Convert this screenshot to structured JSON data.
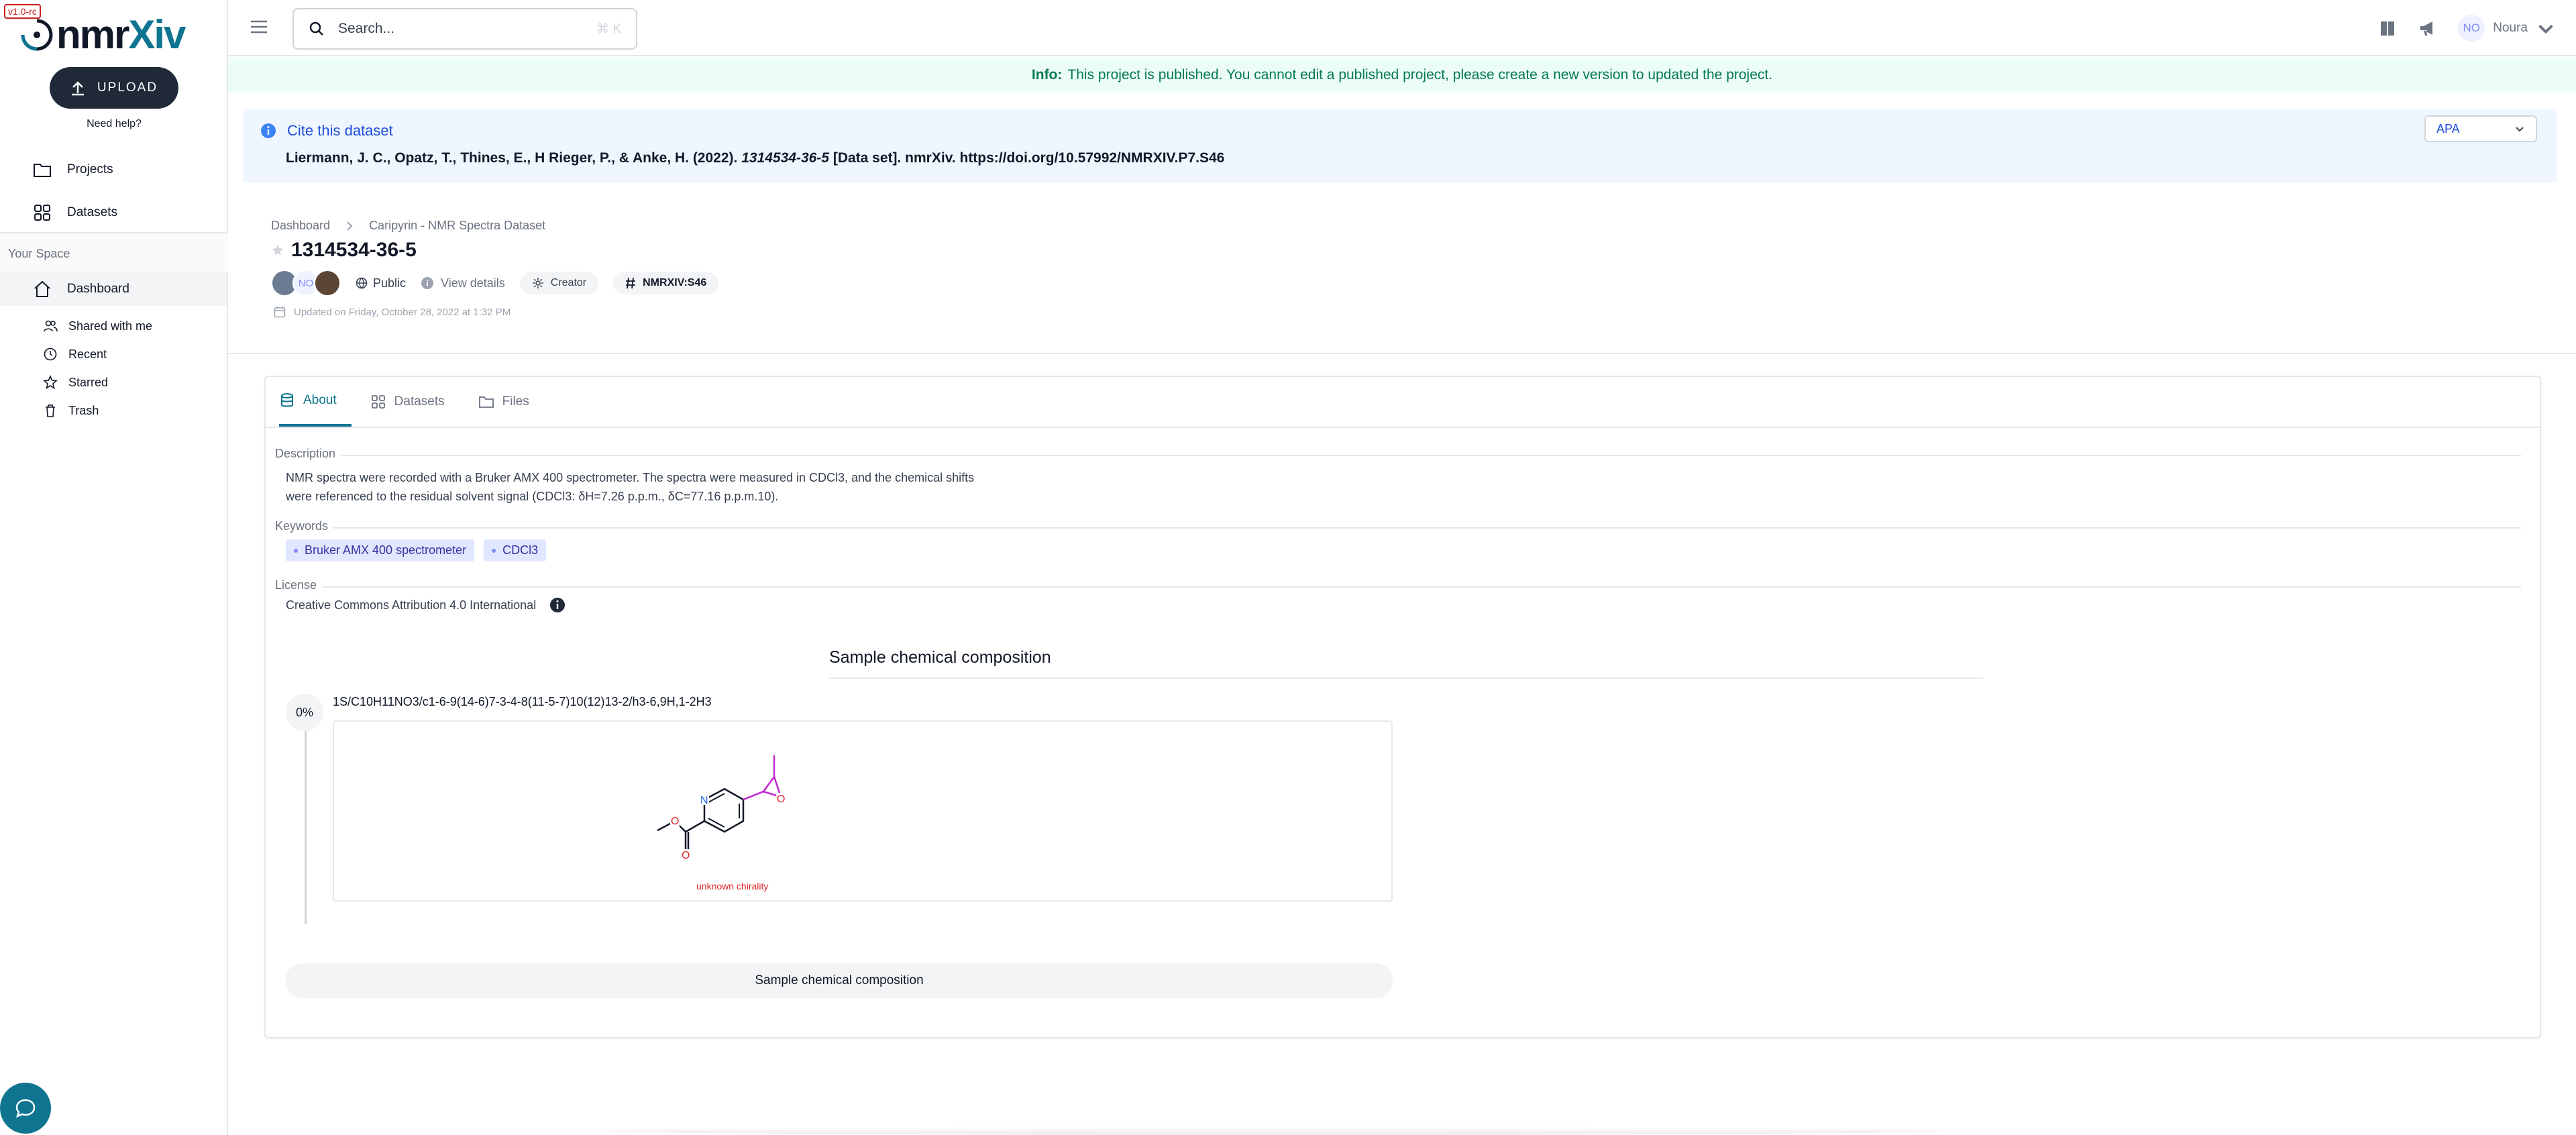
{
  "app": {
    "version": "v1.0-rc",
    "logo_text_main": "nmr",
    "logo_text_accent": "Xiv",
    "upload_label": "UPLOAD",
    "need_help": "Need help?"
  },
  "sidebar": {
    "items": [
      {
        "label": "Projects",
        "icon": "folder-icon"
      },
      {
        "label": "Datasets",
        "icon": "grid-icon"
      }
    ],
    "section_label": "Your Space",
    "dashboard_label": "Dashboard",
    "sub_items": [
      {
        "label": "Shared with me",
        "icon": "users-icon"
      },
      {
        "label": "Recent",
        "icon": "clock-icon"
      },
      {
        "label": "Starred",
        "icon": "star-icon"
      },
      {
        "label": "Trash",
        "icon": "trash-icon"
      }
    ]
  },
  "topbar": {
    "search_placeholder": "Search...",
    "search_shortcut": "⌘ K",
    "user_initials": "NO",
    "user_name": "Noura"
  },
  "banner": {
    "prefix": "Info:",
    "message": "This project is published. You cannot edit a published project, please create a new version to updated the project."
  },
  "cite": {
    "title": "Cite this dataset",
    "authors": "Liermann, J. C., Opatz, T., Thines, E., H Rieger, P., & Anke, H. (2022).",
    "dataset_title": "1314534-36-5",
    "rest": "[Data set]. nmrXiv. https://doi.org/10.57992/NMRXIV.P7.S46",
    "format": "APA"
  },
  "header": {
    "breadcrumb_root": "Dashboard",
    "breadcrumb_project": "Caripyrin - NMR Spectra Dataset",
    "title": "1314534-36-5",
    "avatar_initials": "NO",
    "visibility": "Public",
    "view_details": "View details",
    "role": "Creator",
    "identifier": "NMRXIV:S46",
    "updated": "Updated on Friday, October 28, 2022 at 1:32 PM"
  },
  "tabs": [
    {
      "label": "About",
      "icon": "database-icon",
      "active": true
    },
    {
      "label": "Datasets",
      "icon": "grid-icon",
      "active": false
    },
    {
      "label": "Files",
      "icon": "folder-icon",
      "active": false
    }
  ],
  "about": {
    "description_label": "Description",
    "description_line1": "NMR spectra were recorded with a Bruker AMX 400 spectrometer. The spectra were measured in CDCl3, and the chemical shifts",
    "description_line2": "were referenced to the residual solvent signal (CDCl3: δH=7.26 p.p.m., δC=77.16 p.p.m.10).",
    "keywords_label": "Keywords",
    "keywords": [
      "Bruker AMX 400 spectrometer",
      "CDCl3"
    ],
    "license_label": "License",
    "license": "Creative Commons Attribution 4.0 International"
  },
  "composition": {
    "title": "Sample chemical composition",
    "percent": "0%",
    "inchi": "1S/C10H11NO3/c1-6-9(14-6)7-3-4-8(11-5-7)10(12)13-2/h3-6,9H,1-2H3",
    "molecule_atoms": {
      "nitrogen": "N",
      "oxygen1": "O",
      "oxygen2": "O",
      "oxygen3": "O"
    },
    "chirality_note": "unknown chirality",
    "button_label": "Sample chemical composition"
  },
  "colors": {
    "accent": "#0e7490",
    "banner_bg": "#ecfdf5",
    "banner_text": "#047857",
    "cite_bg": "#eff6ff",
    "keyword_bg": "#e0e7ff"
  }
}
